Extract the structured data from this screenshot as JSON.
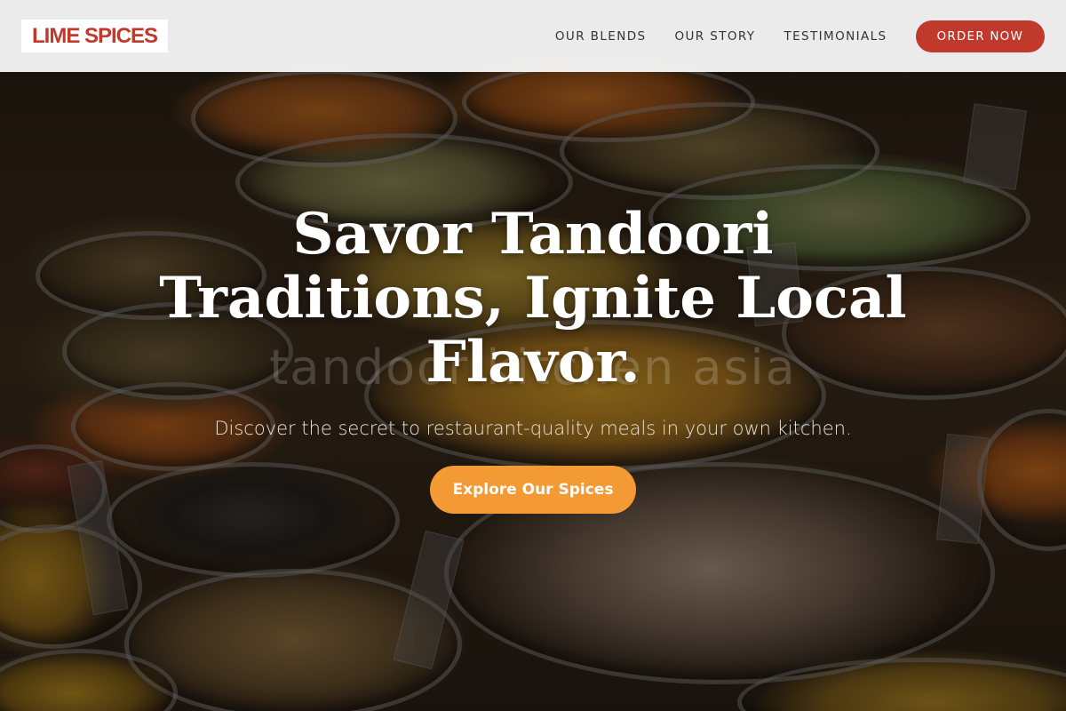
{
  "header": {
    "logo": "LIME SPICES",
    "nav": [
      {
        "label": "OUR BLENDS"
      },
      {
        "label": "OUR STORY"
      },
      {
        "label": "TESTIMONIALS"
      }
    ],
    "cta_label": "ORDER NOW"
  },
  "hero": {
    "headline": "Savor Tandoori Traditions, Ignite Local Flavor.",
    "watermark": "tandoor kitchen asia",
    "subline": "Discover the secret to restaurant-quality meals in your own kitchen.",
    "cta_label": "Explore Our Spices"
  },
  "colors": {
    "brand_red": "#c0392b",
    "cta_orange": "#f39a35",
    "header_bg": "#f5f5f5"
  }
}
